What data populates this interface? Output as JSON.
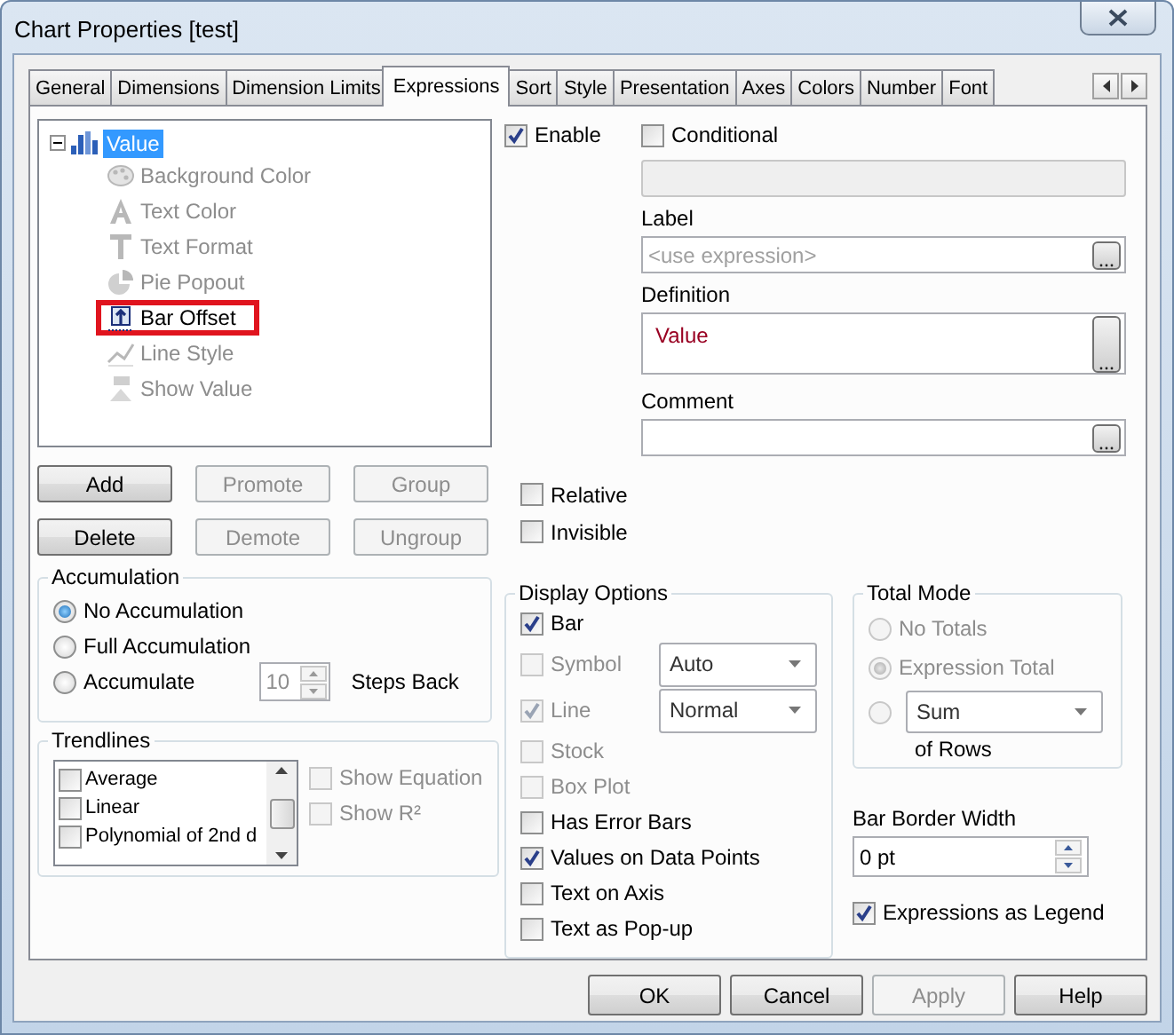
{
  "window": {
    "title": "Chart Properties [test]"
  },
  "tabs": [
    {
      "label": "General",
      "selected": false
    },
    {
      "label": "Dimensions",
      "selected": false
    },
    {
      "label": "Dimension Limits",
      "selected": false
    },
    {
      "label": "Expressions",
      "selected": true
    },
    {
      "label": "Sort",
      "selected": false
    },
    {
      "label": "Style",
      "selected": false
    },
    {
      "label": "Presentation",
      "selected": false
    },
    {
      "label": "Axes",
      "selected": false
    },
    {
      "label": "Colors",
      "selected": false
    },
    {
      "label": "Number",
      "selected": false
    },
    {
      "label": "Font",
      "selected": false
    }
  ],
  "tree": {
    "label": "Value",
    "selected": true,
    "expanded": true,
    "children": [
      {
        "label": "Background Color",
        "kind": "palette",
        "disabled": true,
        "highlighted": false
      },
      {
        "label": "Text Color",
        "kind": "letter-a",
        "disabled": true,
        "highlighted": false
      },
      {
        "label": "Text Format",
        "kind": "letter-t",
        "disabled": true,
        "highlighted": false
      },
      {
        "label": "Pie Popout",
        "kind": "pie",
        "disabled": true,
        "highlighted": false
      },
      {
        "label": "Bar Offset",
        "kind": "offset",
        "disabled": false,
        "highlighted": true
      },
      {
        "label": "Line Style",
        "kind": "line",
        "disabled": true,
        "highlighted": false
      },
      {
        "label": "Show Value",
        "kind": "value",
        "disabled": true,
        "highlighted": false
      }
    ]
  },
  "expression_buttons": [
    {
      "label": "Add",
      "disabled": false
    },
    {
      "label": "Promote",
      "disabled": true
    },
    {
      "label": "Group",
      "disabled": true
    },
    {
      "label": "Delete",
      "disabled": false
    },
    {
      "label": "Demote",
      "disabled": true
    },
    {
      "label": "Ungroup",
      "disabled": true
    }
  ],
  "accumulation": {
    "title": "Accumulation",
    "options": [
      {
        "label": "No Accumulation",
        "selected": true
      },
      {
        "label": "Full Accumulation",
        "selected": false
      },
      {
        "label": "Accumulate",
        "selected": false
      }
    ],
    "steps": "10",
    "steps_label": "Steps Back"
  },
  "trendlines": {
    "title": "Trendlines",
    "items": [
      {
        "label": "Average",
        "checked": false
      },
      {
        "label": "Linear",
        "checked": false
      },
      {
        "label": "Polynomial of 2nd d",
        "checked": false
      }
    ],
    "options": [
      {
        "label": "Show Equation",
        "checked": false,
        "disabled": true
      },
      {
        "label": "Show R²",
        "checked": false,
        "disabled": true
      }
    ]
  },
  "enable": {
    "label": "Enable",
    "checked": true
  },
  "conditional": {
    "label": "Conditional",
    "checked": false
  },
  "label_field": {
    "caption": "Label",
    "placeholder": "<use expression>"
  },
  "definition": {
    "caption": "Definition",
    "value": "Value"
  },
  "comment": {
    "caption": "Comment"
  },
  "flags": [
    {
      "label": "Relative",
      "checked": false
    },
    {
      "label": "Invisible",
      "checked": false
    }
  ],
  "display_options": {
    "title": "Display Options",
    "items": [
      {
        "kind": "checkbox",
        "label": "Bar",
        "checked": true,
        "disabled": false
      },
      {
        "kind": "checkbox-select",
        "label": "Symbol",
        "checked": false,
        "disabled": true,
        "select": "Auto"
      },
      {
        "kind": "checkbox-select",
        "label": "Line",
        "checked": true,
        "disabled": true,
        "select": "Normal"
      },
      {
        "kind": "checkbox",
        "label": "Stock",
        "checked": false,
        "disabled": true
      },
      {
        "kind": "checkbox",
        "label": "Box Plot",
        "checked": false,
        "disabled": true
      },
      {
        "kind": "checkbox",
        "label": "Has Error Bars",
        "checked": false,
        "disabled": false
      },
      {
        "kind": "checkbox",
        "label": "Values on Data Points",
        "checked": true,
        "disabled": false
      },
      {
        "kind": "checkbox",
        "label": "Text on Axis",
        "checked": false,
        "disabled": false
      },
      {
        "kind": "checkbox",
        "label": "Text as Pop-up",
        "checked": false,
        "disabled": false
      }
    ]
  },
  "total_mode": {
    "title": "Total Mode",
    "options": [
      {
        "kind": "radio",
        "label": "No Totals",
        "selected": false,
        "disabled": true
      },
      {
        "kind": "radio",
        "label": "Expression Total",
        "selected": true,
        "disabled": true
      },
      {
        "kind": "radio-select",
        "select": "Sum",
        "selected": false,
        "disabled": true
      }
    ],
    "suffix": "of Rows"
  },
  "bar_border_width": {
    "caption": "Bar Border Width",
    "value": "0 pt"
  },
  "legend_option": {
    "label": "Expressions as Legend",
    "checked": true
  },
  "footer_buttons": [
    {
      "label": "OK",
      "disabled": false
    },
    {
      "label": "Cancel",
      "disabled": false
    },
    {
      "label": "Apply",
      "disabled": true
    },
    {
      "label": "Help",
      "disabled": false
    }
  ]
}
